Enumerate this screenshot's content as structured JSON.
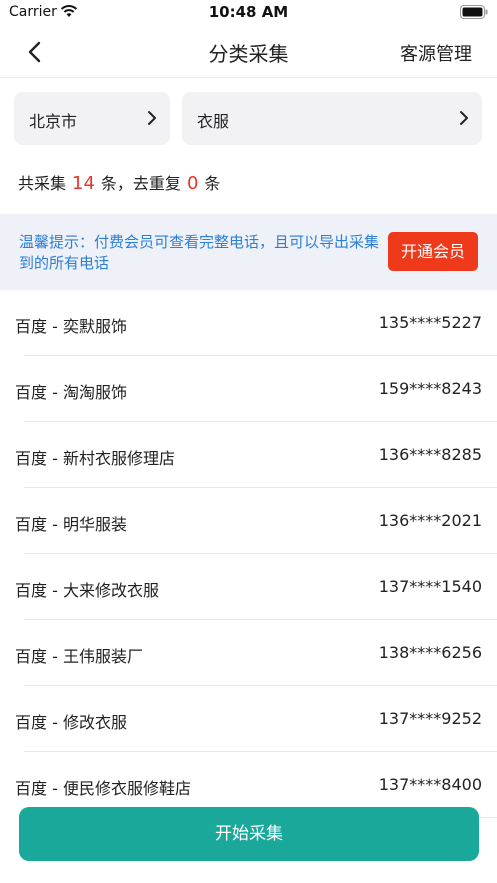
{
  "status_bar": {
    "carrier": "Carrier",
    "time": "10:48 AM"
  },
  "nav": {
    "title": "分类采集",
    "right_label": "客源管理"
  },
  "filters": {
    "city": "北京市",
    "category": "衣服"
  },
  "stats": {
    "prefix": "共采集",
    "total": "14",
    "mid": "条，去重复",
    "duplicates": "0",
    "suffix": "条"
  },
  "notice": {
    "text": "温馨提示：付费会员可查看完整电话，且可以导出采集到的所有电话",
    "button_label": "开通会员"
  },
  "records": [
    {
      "name": "百度 - 奕默服饰",
      "phone": "135****5227"
    },
    {
      "name": "百度 - 淘淘服饰",
      "phone": "159****8243"
    },
    {
      "name": "百度 - 新村衣服修理店",
      "phone": "136****8285"
    },
    {
      "name": "百度 - 明华服装",
      "phone": "136****2021"
    },
    {
      "name": "百度 - 大来修改衣服",
      "phone": "137****1540"
    },
    {
      "name": "百度 - 王伟服装厂",
      "phone": "138****6256"
    },
    {
      "name": "百度 - 修改衣服",
      "phone": "137****9252"
    },
    {
      "name": "百度 - 便民修衣服修鞋店",
      "phone": "137****8400"
    }
  ],
  "start_button": "开始采集",
  "colors": {
    "accent": "#1aa89a",
    "vip": "#ee3a1a",
    "count": "#e8362c",
    "notice_text": "#2b7fd6"
  }
}
